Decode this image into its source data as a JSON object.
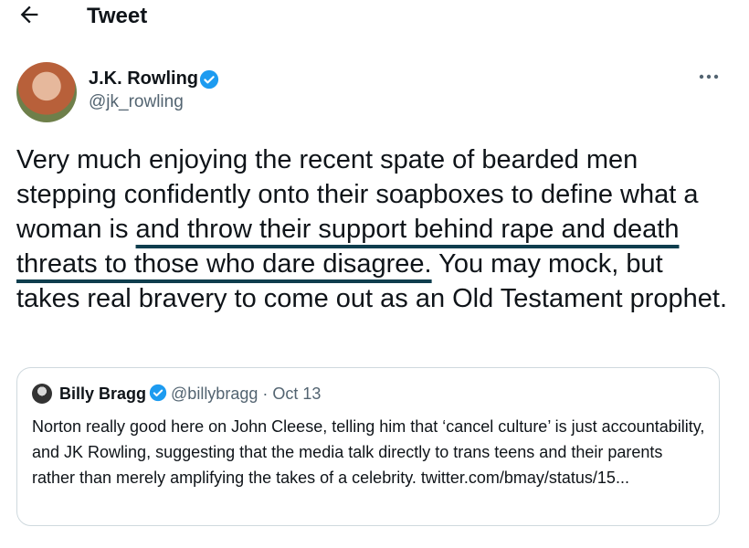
{
  "header": {
    "title": "Tweet",
    "back_icon": "arrow-left-icon"
  },
  "author": {
    "name": "J.K. Rowling",
    "handle": "@jk_rowling",
    "verified": true,
    "more_icon": "more-horizontal-icon"
  },
  "tweet": {
    "text_before": "Very much enjoying the recent spate of bearded men stepping confidently onto their soapboxes to define what a woman is ",
    "text_underlined": "and throw their support behind rape and death threats to those who dare disagree.",
    "text_after": " You may mock, but takes real bravery to come out as an Old Testament prophet."
  },
  "quote": {
    "name": "Billy Bragg",
    "verified": true,
    "handle": "@billybragg",
    "separator": "·",
    "date": "Oct 13",
    "text": "Norton really good here on John Cleese, telling him that ‘cancel culture’ is just accountability, and JK Rowling, suggesting that the media talk directly to trans teens and their parents rather than merely amplifying the takes of a celebrity. twitter.com/bmay/status/15..."
  },
  "colors": {
    "verified_blue": "#1d9bf0",
    "secondary_text": "#536471",
    "underline": "#0f3e4e",
    "card_border": "#cfd9de"
  }
}
